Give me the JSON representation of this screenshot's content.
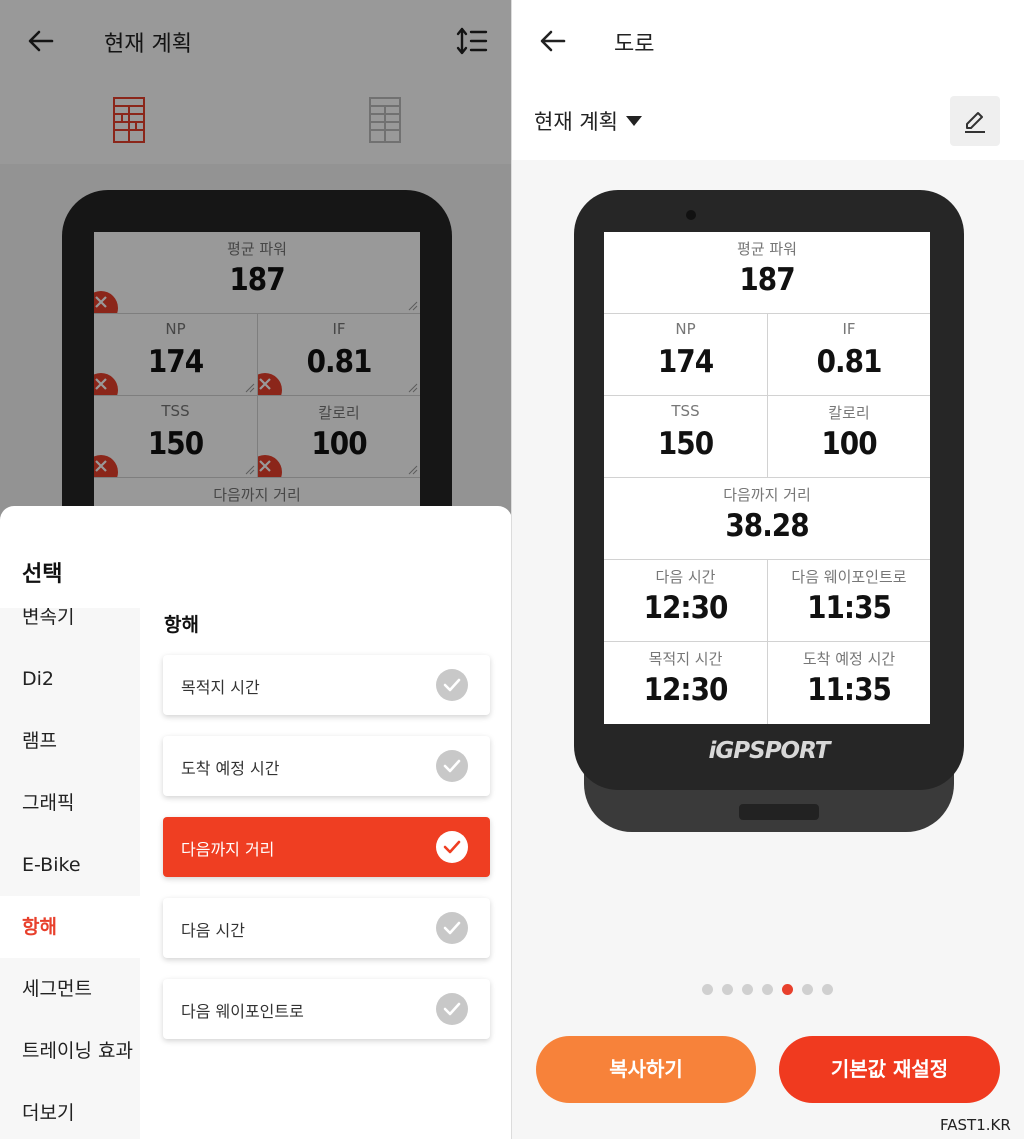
{
  "left": {
    "title": "현재 계획",
    "fields": [
      {
        "label": "평균 파워",
        "value": "187"
      },
      {
        "label": "NP",
        "value": "174"
      },
      {
        "label": "IF",
        "value": "0.81"
      },
      {
        "label": "TSS",
        "value": "150"
      },
      {
        "label": "칼로리",
        "value": "100"
      },
      {
        "label": "다음까지 거리",
        "value": ""
      }
    ],
    "sheet": {
      "title": "선택",
      "categories": [
        "변속기",
        "Di2",
        "램프",
        "그래픽",
        "E-Bike",
        "항해",
        "세그먼트",
        "트레이닝 효과",
        "더보기"
      ],
      "active_category": "항해",
      "section_title": "항해",
      "options": [
        {
          "label": "목적지 시간",
          "selected": false
        },
        {
          "label": "도착 예정 시간",
          "selected": false
        },
        {
          "label": "다음까지 거리",
          "selected": true
        },
        {
          "label": "다음 시간",
          "selected": false
        },
        {
          "label": "다음 웨이포인트로",
          "selected": false
        }
      ]
    }
  },
  "right": {
    "title": "도로",
    "plan_select": "현재 계획",
    "fields": [
      {
        "label": "평균 파워",
        "value": "187"
      },
      {
        "label": "NP",
        "value": "174"
      },
      {
        "label": "IF",
        "value": "0.81"
      },
      {
        "label": "TSS",
        "value": "150"
      },
      {
        "label": "칼로리",
        "value": "100"
      },
      {
        "label": "다음까지 거리",
        "value": "38.28"
      },
      {
        "label": "다음 시간",
        "value": "12:30"
      },
      {
        "label": "다음 웨이포인트로",
        "value": "11:35"
      },
      {
        "label": "목적지 시간",
        "value": "12:30"
      },
      {
        "label": "도착 예정 시간",
        "value": "11:35"
      }
    ],
    "brand": "iGPSPORT",
    "pager": {
      "count": 7,
      "active_index": 4
    },
    "copy_label": "복사하기",
    "reset_label": "기본값 재설정"
  },
  "watermark": "FAST1.KR",
  "colors": {
    "accent": "#e8402c",
    "accent_orange": "#f7823a",
    "device": "#262626"
  },
  "icons": [
    "back-arrow-icon",
    "sort-icon",
    "grid-layout-icon",
    "remove-icon",
    "check-icon",
    "caret-down-icon",
    "edit-pencil-icon"
  ]
}
